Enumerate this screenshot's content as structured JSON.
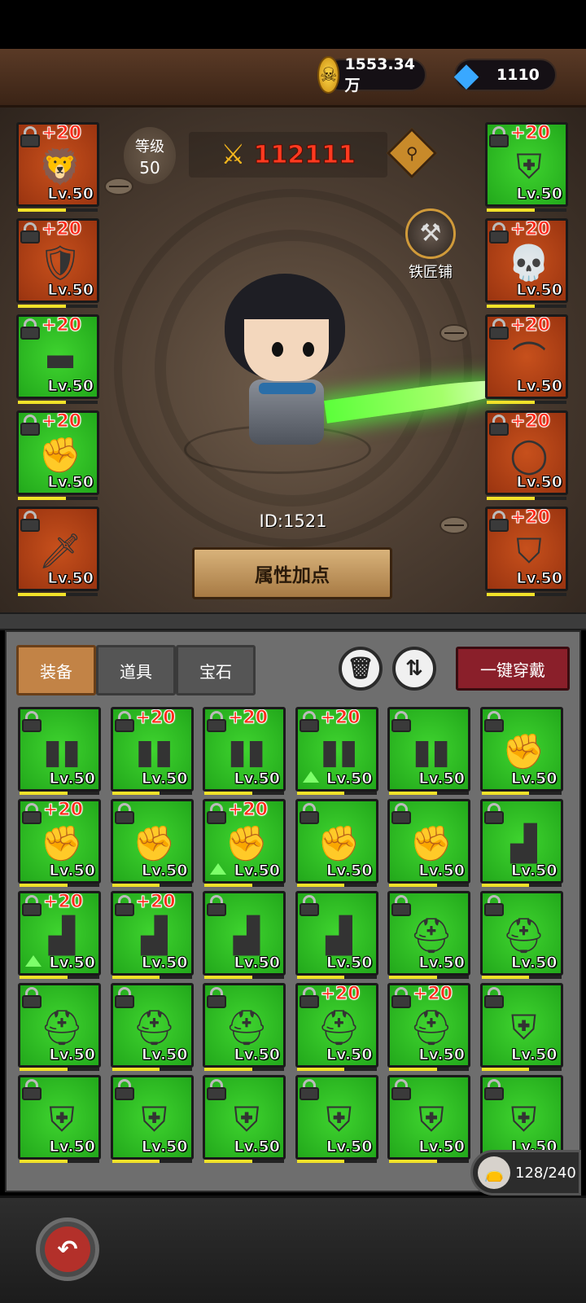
{
  "resources": {
    "gold": "1553.34万",
    "gems": "1110"
  },
  "hero": {
    "level_label": "等级",
    "level_value": "50",
    "power": "112111",
    "blacksmith_label": "铁匠铺",
    "player_id": "ID:1521",
    "attr_button": "属性加点"
  },
  "left_slots": [
    {
      "plus": "+20",
      "lv": "Lv.50",
      "color": "red",
      "icon": "lion-helmet-icon",
      "glyph": "🦁"
    },
    {
      "plus": "+20",
      "lv": "Lv.50",
      "color": "red",
      "icon": "shoulder-armor-icon",
      "glyph": "🛡"
    },
    {
      "plus": "+20",
      "lv": "Lv.50",
      "color": "green",
      "icon": "belt-armor-icon",
      "glyph": "▬"
    },
    {
      "plus": "+20",
      "lv": "Lv.50",
      "color": "green",
      "icon": "gauntlet-icon",
      "glyph": "✊"
    },
    {
      "plus": "",
      "lv": "Lv.50",
      "color": "red",
      "icon": "dagger-icon",
      "glyph": "🗡"
    }
  ],
  "right_slots": [
    {
      "plus": "+20",
      "lv": "Lv.50",
      "color": "green",
      "icon": "chest-armor-icon",
      "glyph": "⛨"
    },
    {
      "plus": "+20",
      "lv": "Lv.50",
      "color": "red",
      "icon": "skull-necklace-icon",
      "glyph": "💀"
    },
    {
      "plus": "+20",
      "lv": "Lv.50",
      "color": "red",
      "icon": "horn-icon",
      "glyph": "⌒"
    },
    {
      "plus": "+20",
      "lv": "Lv.50",
      "color": "red",
      "icon": "ring-icon",
      "glyph": "◯"
    },
    {
      "plus": "+20",
      "lv": "Lv.50",
      "color": "red",
      "icon": "round-shield-icon",
      "glyph": "⛉"
    }
  ],
  "tabs": [
    "装备",
    "道具",
    "宝石"
  ],
  "equip_all": "一键穿戴",
  "inventory": [
    {
      "plus": "",
      "lv": "Lv.50",
      "up": false,
      "icon": "pants-icon",
      "glyph": "▮▮"
    },
    {
      "plus": "+20",
      "lv": "Lv.50",
      "up": false,
      "icon": "pants-icon",
      "glyph": "▮▮"
    },
    {
      "plus": "+20",
      "lv": "Lv.50",
      "up": false,
      "icon": "gold-pants-icon",
      "glyph": "▮▮"
    },
    {
      "plus": "+20",
      "lv": "Lv.50",
      "up": true,
      "icon": "red-pants-icon",
      "glyph": "▮▮"
    },
    {
      "plus": "",
      "lv": "Lv.50",
      "up": false,
      "icon": "white-pants-icon",
      "glyph": "▮▮"
    },
    {
      "plus": "",
      "lv": "Lv.50",
      "up": false,
      "icon": "gauntlet-icon",
      "glyph": "✊"
    },
    {
      "plus": "+20",
      "lv": "Lv.50",
      "up": false,
      "icon": "gold-gauntlet-icon",
      "glyph": "✊"
    },
    {
      "plus": "",
      "lv": "Lv.50",
      "up": false,
      "icon": "gauntlet-icon",
      "glyph": "✊"
    },
    {
      "plus": "+20",
      "lv": "Lv.50",
      "up": true,
      "icon": "red-gauntlet-icon",
      "glyph": "✊"
    },
    {
      "plus": "",
      "lv": "Lv.50",
      "up": false,
      "icon": "white-gauntlet-icon",
      "glyph": "✊"
    },
    {
      "plus": "",
      "lv": "Lv.50",
      "up": false,
      "icon": "gauntlet-icon",
      "glyph": "✊"
    },
    {
      "plus": "",
      "lv": "Lv.50",
      "up": false,
      "icon": "boot-icon",
      "glyph": "▟"
    },
    {
      "plus": "+20",
      "lv": "Lv.50",
      "up": true,
      "icon": "gold-boot-icon",
      "glyph": "▟"
    },
    {
      "plus": "+20",
      "lv": "Lv.50",
      "up": false,
      "icon": "red-boot-icon",
      "glyph": "▟"
    },
    {
      "plus": "",
      "lv": "Lv.50",
      "up": false,
      "icon": "white-boot-icon",
      "glyph": "▟"
    },
    {
      "plus": "",
      "lv": "Lv.50",
      "up": false,
      "icon": "boot-icon",
      "glyph": "▟"
    },
    {
      "plus": "",
      "lv": "Lv.50",
      "up": false,
      "icon": "helmet-icon",
      "glyph": "⛑"
    },
    {
      "plus": "",
      "lv": "Lv.50",
      "up": false,
      "icon": "helmet-icon",
      "glyph": "⛑"
    },
    {
      "plus": "",
      "lv": "Lv.50",
      "up": false,
      "icon": "skull-helmet-icon",
      "glyph": "⛑"
    },
    {
      "plus": "",
      "lv": "Lv.50",
      "up": false,
      "icon": "helmet-icon",
      "glyph": "⛑"
    },
    {
      "plus": "",
      "lv": "Lv.50",
      "up": false,
      "icon": "helmet-icon",
      "glyph": "⛑"
    },
    {
      "plus": "+20",
      "lv": "Lv.50",
      "up": false,
      "icon": "helmet-icon",
      "glyph": "⛑"
    },
    {
      "plus": "+20",
      "lv": "Lv.50",
      "up": false,
      "icon": "gold-helmet-icon",
      "glyph": "⛑"
    },
    {
      "plus": "",
      "lv": "Lv.50",
      "up": false,
      "icon": "chest-armor-icon",
      "glyph": "⛨"
    },
    {
      "plus": "",
      "lv": "Lv.50",
      "up": false,
      "icon": "chest-armor-icon",
      "glyph": "⛨"
    },
    {
      "plus": "",
      "lv": "Lv.50",
      "up": false,
      "icon": "chest-armor-icon",
      "glyph": "⛨"
    },
    {
      "plus": "",
      "lv": "Lv.50",
      "up": false,
      "icon": "chest-armor-icon",
      "glyph": "⛨"
    },
    {
      "plus": "",
      "lv": "Lv.50",
      "up": false,
      "icon": "gold-chest-armor-icon",
      "glyph": "⛨"
    },
    {
      "plus": "",
      "lv": "Lv.50",
      "up": false,
      "icon": "red-chest-armor-icon",
      "glyph": "⛨"
    },
    {
      "plus": "",
      "lv": "Lv.50",
      "up": false,
      "icon": "white-chest-armor-icon",
      "glyph": "⛨"
    }
  ],
  "bag_count": "128/240",
  "colors": {
    "red_slot": "#b2421a",
    "green_slot": "#2fbf22",
    "plus_text": "#ff2a1a",
    "power_text": "#ff3a20",
    "tab_active": "#c28346",
    "equip_all_bg": "#8a1f2a"
  }
}
